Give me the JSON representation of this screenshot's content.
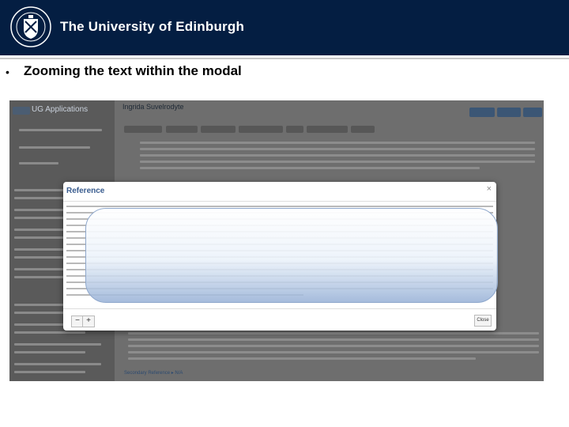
{
  "header": {
    "university_name": "The University of Edinburgh",
    "background_color": "#041e42"
  },
  "slide": {
    "bullet": "•",
    "title": "Zooming the text within the modal"
  },
  "app": {
    "title": "UG Applications",
    "applicant_name": "Ingrida Suvelrodyte"
  },
  "modal": {
    "title": "Reference",
    "close_glyph": "×",
    "zoom_out_label": "−",
    "zoom_in_label": "+",
    "close_button_label": "Close"
  },
  "footer": {
    "secondary_reference": "Secondary Reference ▸ N/A"
  }
}
